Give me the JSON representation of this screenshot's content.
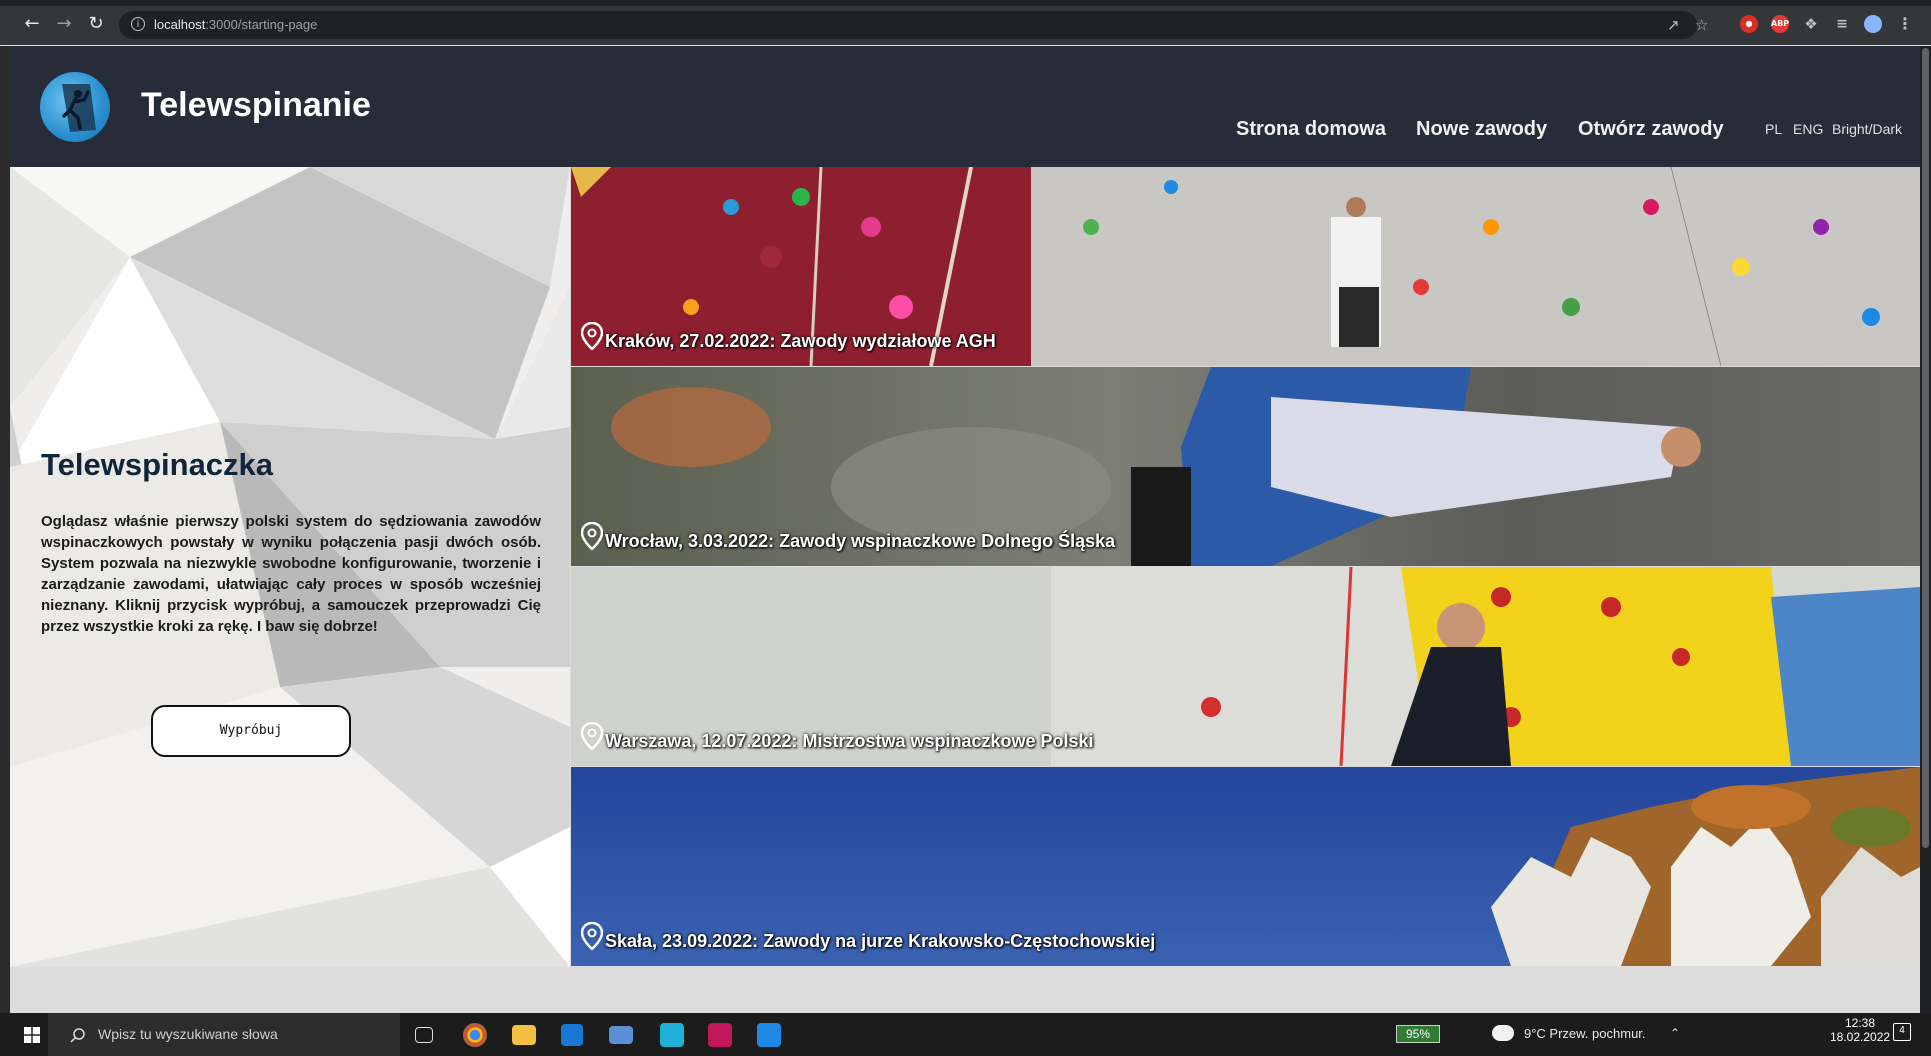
{
  "browser": {
    "url_host": "localhost",
    "url_path": ":3000/starting-page"
  },
  "header": {
    "brand": "Telewspinanie",
    "nav": [
      "Strona domowa",
      "Nowe zawody",
      "Otwórz zawody"
    ],
    "lang": [
      "PL",
      "ENG",
      "Bright/Dark"
    ]
  },
  "intro": {
    "title": "Telewspinaczka",
    "text": "Oglądasz właśnie pierwszy polski system do sędziowania zawodów wspinaczkowych powstały w wyniku połączenia pasji dwóch osób. System pozwala na niezwykle swobodne konfigurowanie, tworzenie i zarządzanie zawodami, ułatwiając cały proces w sposób wcześniej nieznany. Kliknij przycisk wypróbuj, a samouczek przeprowadzi Cię przez wszystkie kroki za rękę. I baw się dobrze!",
    "button": "Wypróbuj"
  },
  "events": [
    {
      "caption": "Kraków, 27.02.2022: Zawody wydziałowe AGH"
    },
    {
      "caption": "Wrocław, 3.03.2022: Zawody wspinaczkowe Dolnego Śląska"
    },
    {
      "caption": "Warszawa, 12.07.2022: Mistrzostwa wspinaczkowe Polski"
    },
    {
      "caption": "Skała, 23.09.2022: Zawody na jurze Krakowsko-Częstochowskiej"
    }
  ],
  "taskbar": {
    "search_placeholder": "Wpisz tu wyszukiwane słowa",
    "battery": "95%",
    "weather": "9°C  Przew. pochmur.",
    "time": "12:38",
    "date": "18.02.2022",
    "notifications": "4"
  }
}
